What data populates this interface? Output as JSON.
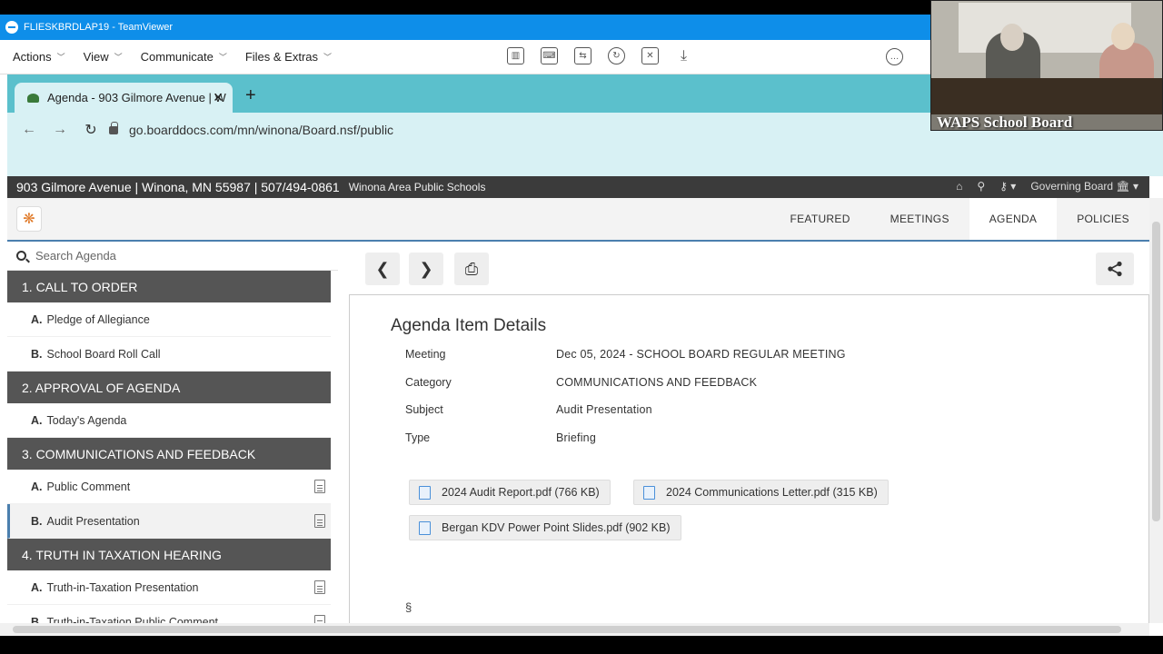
{
  "teamviewer": {
    "title": "FLIESKBRDLAP19 - TeamViewer",
    "menus": [
      "Actions",
      "View",
      "Communicate",
      "Files & Extras"
    ]
  },
  "browser": {
    "tab_title": "Agenda - 903 Gilmore Avenue | W",
    "url": "go.boarddocs.com/mn/winona/Board.nsf/public"
  },
  "site": {
    "address": "903 Gilmore Avenue | Winona, MN 55987 | 507/494-0861",
    "org": "Winona Area Public Schools",
    "governing": "Governing Board",
    "nav": [
      "FEATURED",
      "MEETINGS",
      "AGENDA",
      "POLICIES"
    ]
  },
  "sidebar": {
    "search_placeholder": "Search Agenda",
    "sections": [
      {
        "title": "1. CALL TO ORDER",
        "items": [
          {
            "letter": "A.",
            "label": "Pledge of Allegiance"
          },
          {
            "letter": "B.",
            "label": "School Board Roll Call"
          }
        ]
      },
      {
        "title": "2. APPROVAL OF AGENDA",
        "items": [
          {
            "letter": "A.",
            "label": "Today's Agenda"
          }
        ]
      },
      {
        "title": "3. COMMUNICATIONS AND FEEDBACK",
        "items": [
          {
            "letter": "A.",
            "label": "Public Comment"
          },
          {
            "letter": "B.",
            "label": "Audit Presentation"
          }
        ]
      },
      {
        "title": "4. TRUTH IN TAXATION HEARING",
        "items": [
          {
            "letter": "A.",
            "label": "Truth-in-Taxation Presentation"
          },
          {
            "letter": "B.",
            "label": "Truth-in-Taxation Public Comment"
          }
        ]
      }
    ]
  },
  "details": {
    "title": "Agenda Item Details",
    "rows": [
      {
        "label": "Meeting",
        "value": "Dec 05, 2024 - SCHOOL BOARD REGULAR MEETING"
      },
      {
        "label": "Category",
        "value": "COMMUNICATIONS AND FEEDBACK"
      },
      {
        "label": "Subject",
        "value": "Audit Presentation"
      },
      {
        "label": "Type",
        "value": "Briefing"
      }
    ],
    "attachments": [
      "2024 Audit Report.pdf (766 KB)",
      "2024 Communications Letter.pdf (315 KB)",
      "Bergan KDV Power Point Slides.pdf (902 KB)"
    ],
    "section_mark": "§"
  },
  "video": {
    "caption": "WAPS School Board"
  }
}
